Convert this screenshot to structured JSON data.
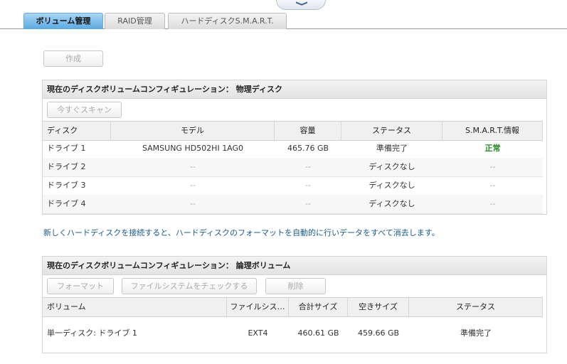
{
  "tabs": [
    "ボリューム管理",
    "RAID管理",
    "ハードディスクS.M.A.R.T."
  ],
  "create_button": "作成",
  "physical": {
    "title": "現在のディスクボリュームコンフィギュレーション： 物理ディスク",
    "scan_button": "今すぐスキャン",
    "columns": [
      "ディスク",
      "モデル",
      "容量",
      "ステータス",
      "S.M.A.R.T.情報"
    ],
    "rows": [
      [
        "ドライブ 1",
        "SAMSUNG HD502HI 1AG0",
        "465.76 GB",
        "準備完了",
        "正常"
      ],
      [
        "ドライブ 2",
        "--",
        "--",
        "ディスクなし",
        "--"
      ],
      [
        "ドライブ 3",
        "--",
        "--",
        "ディスクなし",
        "--"
      ],
      [
        "ドライブ 4",
        "--",
        "--",
        "ディスクなし",
        "--"
      ]
    ]
  },
  "note": "新しくハードディスクを接続すると、ハードディスクのフォーマットを自動的に行いデータをすべて消去します。",
  "logical": {
    "title": "現在のディスクボリュームコンフィギュレーション： 論理ボリューム",
    "buttons": [
      "フォーマット",
      "ファイルシステムをチェックする",
      "削除"
    ],
    "columns": [
      "ボリューム",
      "ファイルシス…",
      "合計サイズ",
      "空きサイズ",
      "ステータス"
    ],
    "rows": [
      [
        "単一ディスク: ドライブ 1",
        "EXT4",
        "460.61 GB",
        "459.66 GB",
        "準備完了"
      ]
    ]
  },
  "colors": {
    "accent": "#5aa9e0",
    "ok": "#2a8a2a",
    "note": "#1a5a8a"
  }
}
